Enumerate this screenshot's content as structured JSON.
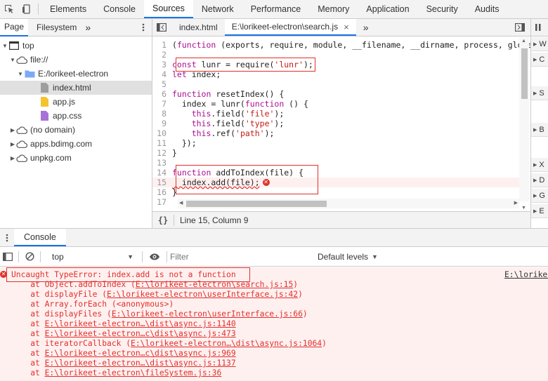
{
  "toolbar": {
    "tabs": [
      "Elements",
      "Console",
      "Sources",
      "Network",
      "Performance",
      "Memory",
      "Application",
      "Security",
      "Audits"
    ],
    "active_tab": "Sources"
  },
  "navigator": {
    "tabs": [
      "Page",
      "Filesystem"
    ],
    "more": "»",
    "tree": [
      {
        "label": "top",
        "depth": 0,
        "icon": "frame-icon",
        "expanded": true
      },
      {
        "label": "file://",
        "depth": 1,
        "icon": "cloud-icon",
        "expanded": true
      },
      {
        "label": "E:/lorikeet-electron",
        "depth": 2,
        "icon": "folder-icon",
        "expanded": true
      },
      {
        "label": "index.html",
        "depth": 3,
        "icon": "html-file-icon",
        "selected": true
      },
      {
        "label": "app.js",
        "depth": 3,
        "icon": "js-file-icon"
      },
      {
        "label": "app.css",
        "depth": 3,
        "icon": "css-file-icon"
      },
      {
        "label": "(no domain)",
        "depth": 1,
        "icon": "cloud-icon",
        "expanded": false
      },
      {
        "label": "apps.bdimg.com",
        "depth": 1,
        "icon": "cloud-icon",
        "expanded": false
      },
      {
        "label": "unpkg.com",
        "depth": 1,
        "icon": "cloud-icon",
        "expanded": false
      }
    ]
  },
  "editor": {
    "tabs": [
      {
        "label": "index.html",
        "active": false
      },
      {
        "label": "E:\\lorikeet-electron\\search.js",
        "active": true,
        "close": "×"
      }
    ],
    "more": "»",
    "lines": [
      {
        "n": "1",
        "text": "(function (exports, require, module, __filename, __dirname, process, globa"
      },
      {
        "n": "2",
        "text": ""
      },
      {
        "n": "3",
        "text": "const lunr = require('lunr');"
      },
      {
        "n": "4",
        "text": "let index;"
      },
      {
        "n": "5",
        "text": ""
      },
      {
        "n": "6",
        "text": "function resetIndex() {"
      },
      {
        "n": "7",
        "text": "  index = lunr(function () {"
      },
      {
        "n": "8",
        "text": "    this.field('file');"
      },
      {
        "n": "9",
        "text": "    this.field('type');"
      },
      {
        "n": "10",
        "text": "    this.ref('path');"
      },
      {
        "n": "11",
        "text": "  });"
      },
      {
        "n": "12",
        "text": "}"
      },
      {
        "n": "13",
        "text": ""
      },
      {
        "n": "14",
        "text": "function addToIndex(file) {"
      },
      {
        "n": "15",
        "text": "  index.add(file);"
      },
      {
        "n": "16",
        "text": "}"
      },
      {
        "n": "17",
        "text": ""
      }
    ],
    "status": "Line 15, Column 9",
    "format_icon": "{}"
  },
  "right_pane": {
    "items": [
      "W",
      "C",
      "S",
      "B",
      "X",
      "D",
      "G",
      "E"
    ]
  },
  "drawer": {
    "tab": "Console",
    "context": "top",
    "filter_placeholder": "Filter",
    "levels": "Default levels"
  },
  "console": {
    "source_link": "E:\\lorikee",
    "error": "Uncaught TypeError: index.add is not a function",
    "stack": [
      {
        "pre": "    at Object.addToIndex (",
        "link": "E:\\lorikeet-electron\\search.js:15",
        "post": ")"
      },
      {
        "pre": "    at displayFile (",
        "link": "E:\\lorikeet-electron\\userInterface.js:42",
        "post": ")"
      },
      {
        "pre": "    at Array.forEach (<anonymous>)",
        "link": "",
        "post": ""
      },
      {
        "pre": "    at displayFiles (",
        "link": "E:\\lorikeet-electron\\userInterface.js:66",
        "post": ")"
      },
      {
        "pre": "    at ",
        "link": "E:\\lorikeet-electron…\\dist\\async.js:1140",
        "post": ""
      },
      {
        "pre": "    at ",
        "link": "E:\\lorikeet-electron…c\\dist\\async.js:473",
        "post": ""
      },
      {
        "pre": "    at iteratorCallback (",
        "link": "E:\\lorikeet-electron…\\dist\\async.js:1064",
        "post": ")"
      },
      {
        "pre": "    at ",
        "link": "E:\\lorikeet-electron…c\\dist\\async.js:969",
        "post": ""
      },
      {
        "pre": "    at ",
        "link": "E:\\lorikeet-electron…\\dist\\async.js:1137",
        "post": ""
      },
      {
        "pre": "    at ",
        "link": "E:\\lorikeet-electron\\fileSystem.js:36",
        "post": ""
      }
    ]
  },
  "colors": {
    "accent": "#1a73e8",
    "error": "#e0302a",
    "error_bg": "#fff0f0"
  }
}
